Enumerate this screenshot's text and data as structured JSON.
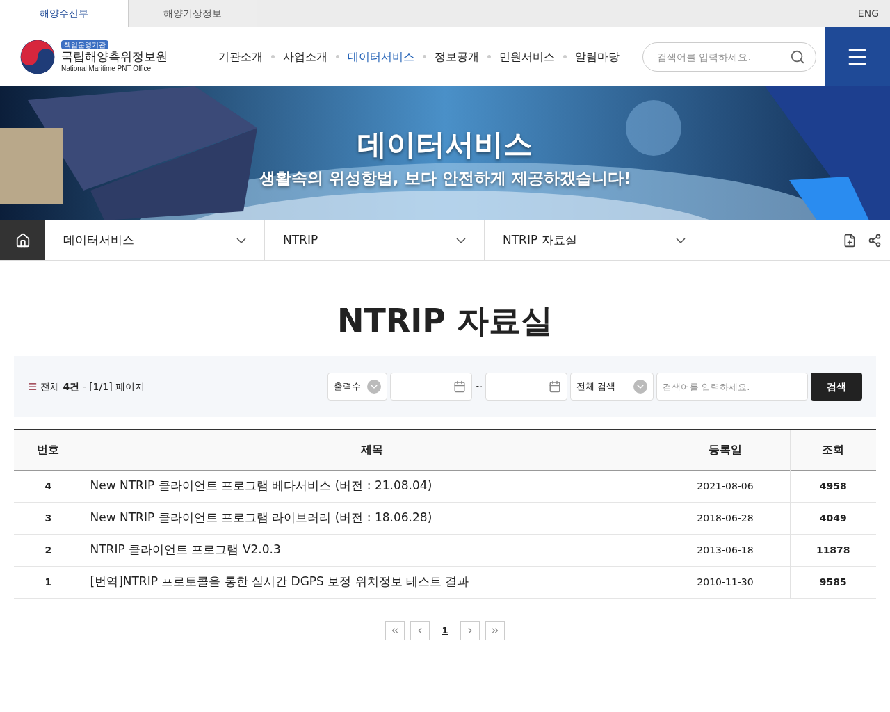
{
  "top_tabs": [
    {
      "label": "해양수산부",
      "selected": true
    },
    {
      "label": "해양기상정보",
      "selected": false
    }
  ],
  "language_link": "ENG",
  "logo": {
    "badge": "책임운영기관",
    "name": "국립해양측위정보원",
    "english_name": "National Maritime PNT Office"
  },
  "nav": [
    {
      "label": "기관소개",
      "selected": false
    },
    {
      "label": "사업소개",
      "selected": false
    },
    {
      "label": "데이터서비스",
      "selected": true
    },
    {
      "label": "정보공개",
      "selected": false
    },
    {
      "label": "민원서비스",
      "selected": false
    },
    {
      "label": "알림마당",
      "selected": false
    }
  ],
  "header_search": {
    "placeholder": "검색어를 입력하세요."
  },
  "banner": {
    "title": "데이터서비스",
    "subtitle": "생활속의 위성항법, 보다 안전하게 제공하겠습니다!"
  },
  "breadcrumb": [
    "데이터서비스",
    "NTRIP",
    "NTRIP 자료실"
  ],
  "page_title": "NTRIP 자료실",
  "filter": {
    "summary": "전체 **4건** - [1/1] 페이지",
    "page_size": "출력수",
    "date_separator": "~",
    "search_scope": "전체 검색",
    "search_placeholder": "검색어를 입력하세요.",
    "search_button": "검색"
  },
  "table": {
    "columns": [
      "번호",
      "제목",
      "등록일",
      "조회"
    ],
    "rows": [
      [
        "4",
        "New NTRIP 클라이언트 프로그램 베타서비스 (버전 : 21.08.04)",
        "2021-08-06",
        "4958"
      ],
      [
        "3",
        "New NTRIP 클라이언트 프로그램 라이브러리 (버전 : 18.06.28)",
        "2018-06-28",
        "4049"
      ],
      [
        "2",
        "NTRIP 클라이언트 프로그램 V2.0.3",
        "2013-06-18",
        "11878"
      ],
      [
        "1",
        "[번역]NTRIP 프로토콜을 통한 실시간 DGPS 보정 위치정보 테스트 결과",
        "2010-11-30",
        "9585"
      ]
    ]
  },
  "pagination": [
    {
      "label": "1",
      "selected": true
    }
  ]
}
